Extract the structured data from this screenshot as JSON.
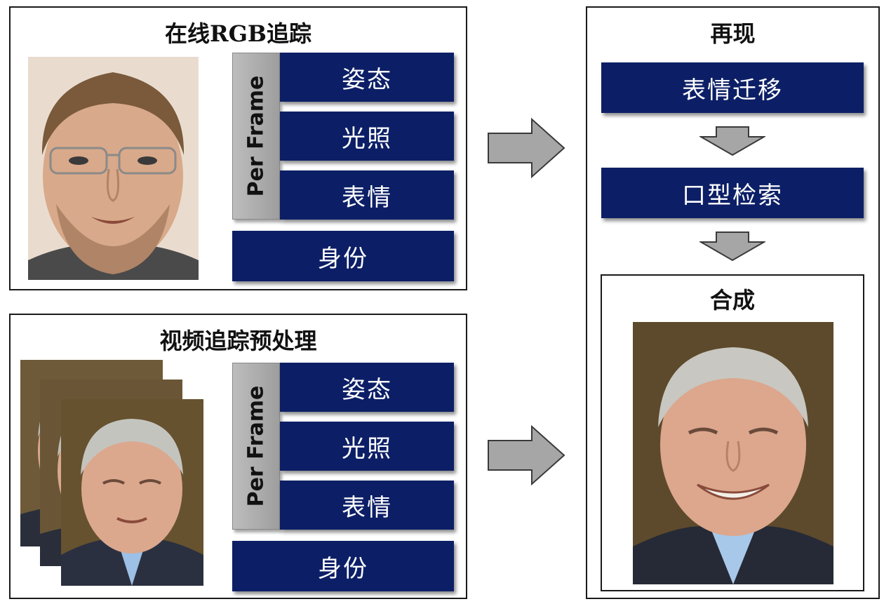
{
  "online": {
    "title": "在线RGB追踪",
    "per_frame": "Per Frame",
    "items": [
      "姿态",
      "光照",
      "表情"
    ],
    "identity": "身份"
  },
  "video": {
    "title": "视频追踪预处理",
    "per_frame": "Per Frame",
    "items": [
      "姿态",
      "光照",
      "表情"
    ],
    "identity": "身份"
  },
  "reenact": {
    "title": "再现",
    "steps": [
      "表情迁移",
      "口型检索"
    ],
    "synthesis_title": "合成"
  },
  "colors": {
    "box_fill": "#0c1f66",
    "arrow_fill": "#a6a6a6",
    "panel_border": "#1a1a1a"
  }
}
